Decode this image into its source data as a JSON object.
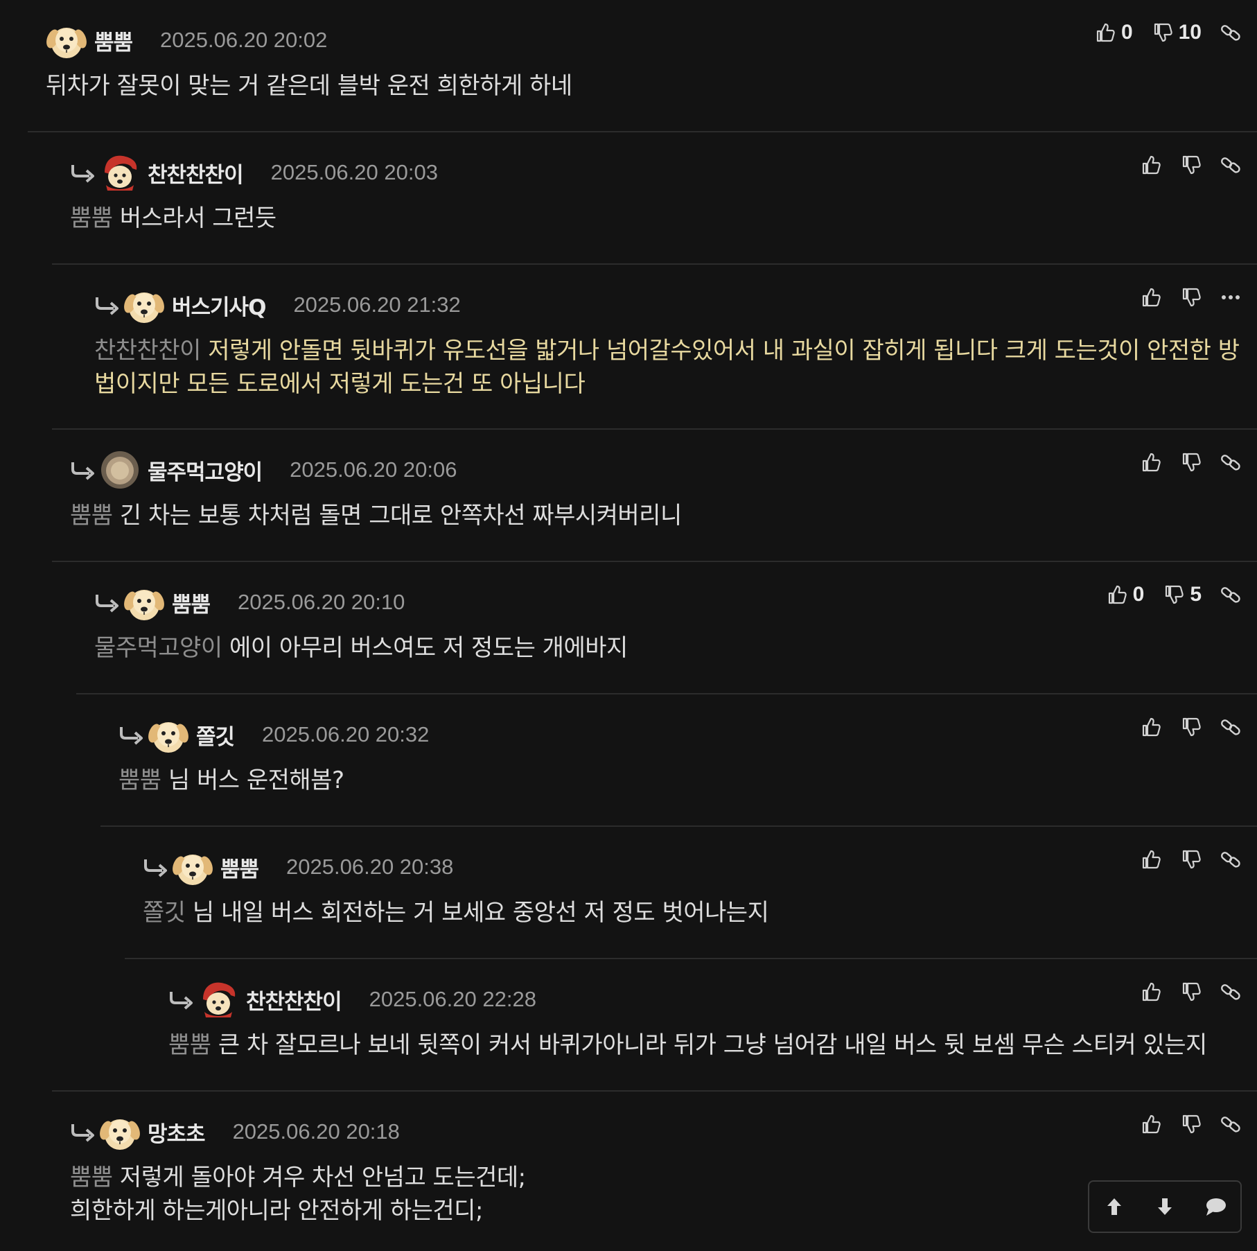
{
  "comments": [
    {
      "nick": "뿜뿜",
      "date": "2025.06.20 20:02",
      "mention": "",
      "text": "뒤차가 잘못이 맞는 거 같은데 블박 운전 희한하게 하네",
      "likes": "0",
      "dislikes": "10",
      "avatar": "dog",
      "menu": "link",
      "highlight": false
    },
    {
      "nick": "찬찬찬찬이",
      "date": "2025.06.20 20:03",
      "mention": "뿜뿜",
      "text": "버스라서 그런듯",
      "likes": "",
      "dislikes": "",
      "avatar": "dog-hood",
      "menu": "link",
      "highlight": false
    },
    {
      "nick": "버스기사Q",
      "date": "2025.06.20 21:32",
      "mention": "찬찬찬찬이",
      "text": "저렇게 안돌면 뒷바퀴가 유도선을 밟거나 넘어갈수있어서 내 과실이 잡히게 됩니다 크게 도는것이 안전한 방법이지만 모든 도로에서 저렇게 도는건 또 아닙니다",
      "likes": "",
      "dislikes": "",
      "avatar": "dog",
      "menu": "more",
      "highlight": true
    },
    {
      "nick": "물주먹고양이",
      "date": "2025.06.20 20:06",
      "mention": "뿜뿜",
      "text": "긴 차는 보통 차처럼 돌면 그대로 안쪽차선 짜부시켜버리니",
      "likes": "",
      "dislikes": "",
      "avatar": "blur",
      "menu": "link",
      "highlight": false
    },
    {
      "nick": "뿜뿜",
      "date": "2025.06.20 20:10",
      "mention": "물주먹고양이",
      "text": "에이 아무리 버스여도 저 정도는 개에바지",
      "likes": "0",
      "dislikes": "5",
      "avatar": "dog",
      "menu": "link",
      "highlight": false
    },
    {
      "nick": "쫄깃",
      "date": "2025.06.20 20:32",
      "mention": "뿜뿜",
      "text": "님 버스 운전해봄?",
      "likes": "",
      "dislikes": "",
      "avatar": "dog",
      "menu": "link",
      "highlight": false
    },
    {
      "nick": "뿜뿜",
      "date": "2025.06.20 20:38",
      "mention": "쫄깃",
      "text": "님 내일 버스 회전하는 거 보세요 중앙선 저 정도 벗어나는지",
      "likes": "",
      "dislikes": "",
      "avatar": "dog",
      "menu": "link",
      "highlight": false
    },
    {
      "nick": "찬찬찬찬이",
      "date": "2025.06.20 22:28",
      "mention": "뿜뿜",
      "text": "큰 차 잘모르나 보네 뒷쪽이 커서 바퀴가아니라 뒤가 그냥 넘어감 내일 버스 뒷 보셈 무슨 스티커 있는지",
      "likes": "",
      "dislikes": "",
      "avatar": "dog-hood",
      "menu": "link",
      "highlight": false
    },
    {
      "nick": "망초초",
      "date": "2025.06.20 20:18",
      "mention": "뿜뿜",
      "text": "저렇게 돌아야 겨우 차선 안넘고 도는건데;",
      "text2": "희한하게 하는게아니라 안전하게 하는건디;",
      "likes": "",
      "dislikes": "",
      "avatar": "dog",
      "menu": "link",
      "highlight": false
    }
  ],
  "nav": {
    "up_icon": "arrow-up-icon",
    "down_icon": "arrow-down-icon",
    "comment_icon": "speech-bubble-icon"
  }
}
